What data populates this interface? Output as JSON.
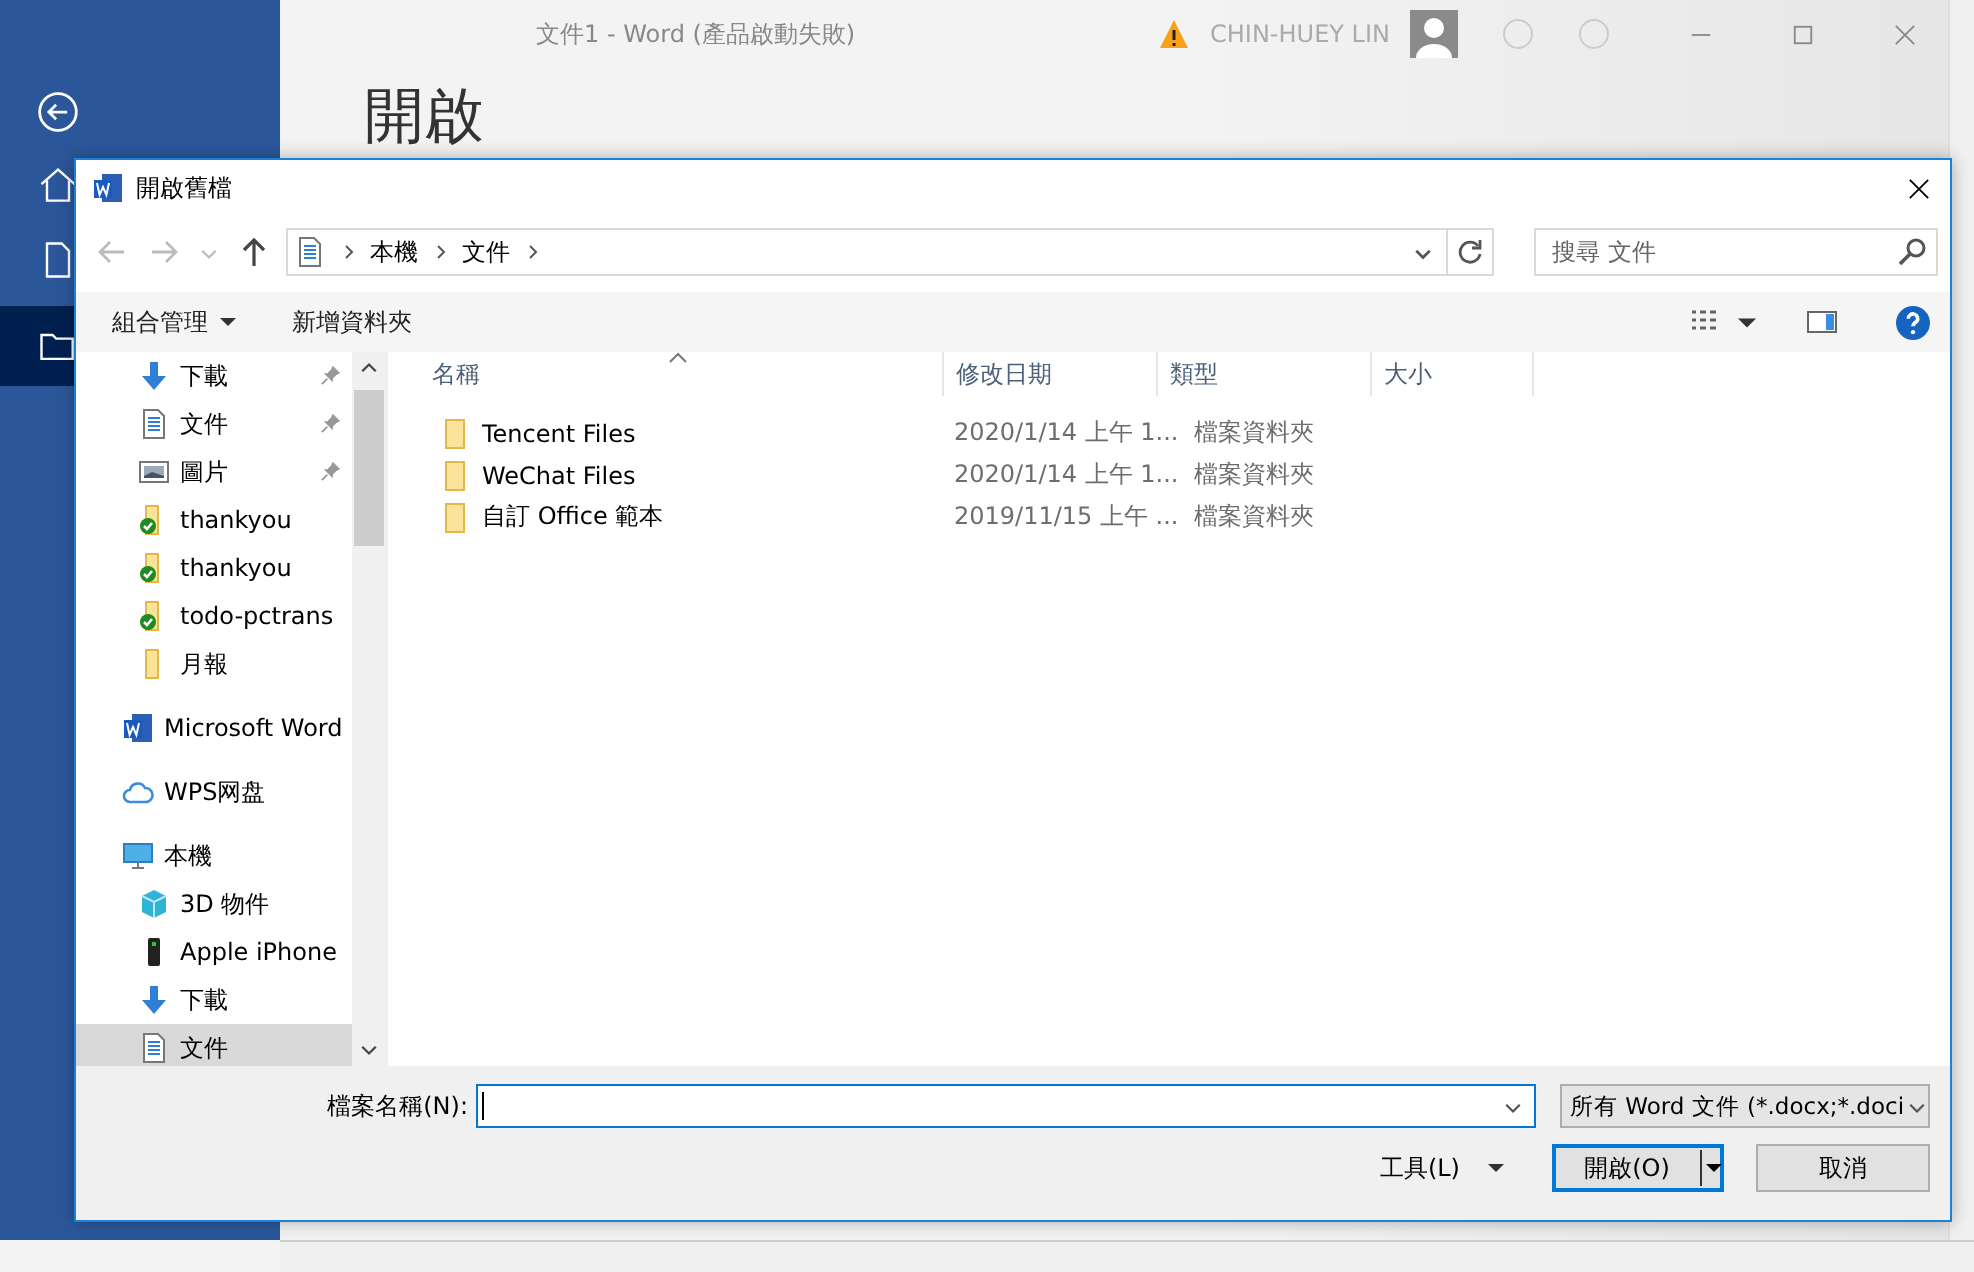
{
  "app": {
    "title": "文件1  -  Word (產品啟動失敗)",
    "user": "CHIN-HUEY LIN",
    "heading": "開啟"
  },
  "dialog": {
    "title": "開啟舊檔",
    "breadcrumbs": [
      "本機",
      "文件"
    ],
    "search": {
      "placeholder": "搜尋 文件"
    },
    "toolbar": {
      "organize": "組合管理",
      "new_folder": "新增資料夾"
    },
    "nav_pane": {
      "quick_access_children": [
        {
          "label": "下載",
          "kind": "download",
          "pinned": true,
          "selected": false
        },
        {
          "label": "文件",
          "kind": "document",
          "pinned": true,
          "selected": false
        },
        {
          "label": "圖片",
          "kind": "picture",
          "pinned": true,
          "selected": false
        },
        {
          "label": "thankyou",
          "kind": "synced-folder",
          "pinned": false,
          "selected": false
        },
        {
          "label": "thankyou",
          "kind": "synced-folder",
          "pinned": false,
          "selected": false
        },
        {
          "label": "todo-pctrans",
          "kind": "synced-folder",
          "pinned": false,
          "selected": false
        },
        {
          "label": "月報",
          "kind": "folder",
          "pinned": false,
          "selected": false
        }
      ],
      "items": [
        {
          "label": "Microsoft Word",
          "kind": "word",
          "selected": false
        },
        {
          "label": "WPS网盘",
          "kind": "cloud",
          "selected": false
        },
        {
          "label": "本機",
          "kind": "computer",
          "selected": false,
          "children": [
            {
              "label": "3D 物件",
              "kind": "cube",
              "selected": false
            },
            {
              "label": "Apple iPhone",
              "kind": "phone",
              "selected": false
            },
            {
              "label": "下載",
              "kind": "download",
              "selected": false
            },
            {
              "label": "文件",
              "kind": "document",
              "selected": true
            }
          ]
        }
      ]
    },
    "table": {
      "columns": [
        "名稱",
        "修改日期",
        "類型",
        "大小"
      ],
      "rows": [
        {
          "name": "Tencent Files",
          "date": "2020/1/14 上午 1...",
          "type": "檔案資料夾"
        },
        {
          "name": "WeChat Files",
          "date": "2020/1/14 上午 1...",
          "type": "檔案資料夾"
        },
        {
          "name": "自訂 Office 範本",
          "date": "2019/11/15 上午 ...",
          "type": "檔案資料夾"
        }
      ]
    },
    "filename_label": "檔案名稱(N):",
    "file_type": "所有 Word 文件 (*.docx;*.doci",
    "tools": "工具(L)",
    "open_button": "開啟(O)",
    "cancel_button": "取消"
  }
}
